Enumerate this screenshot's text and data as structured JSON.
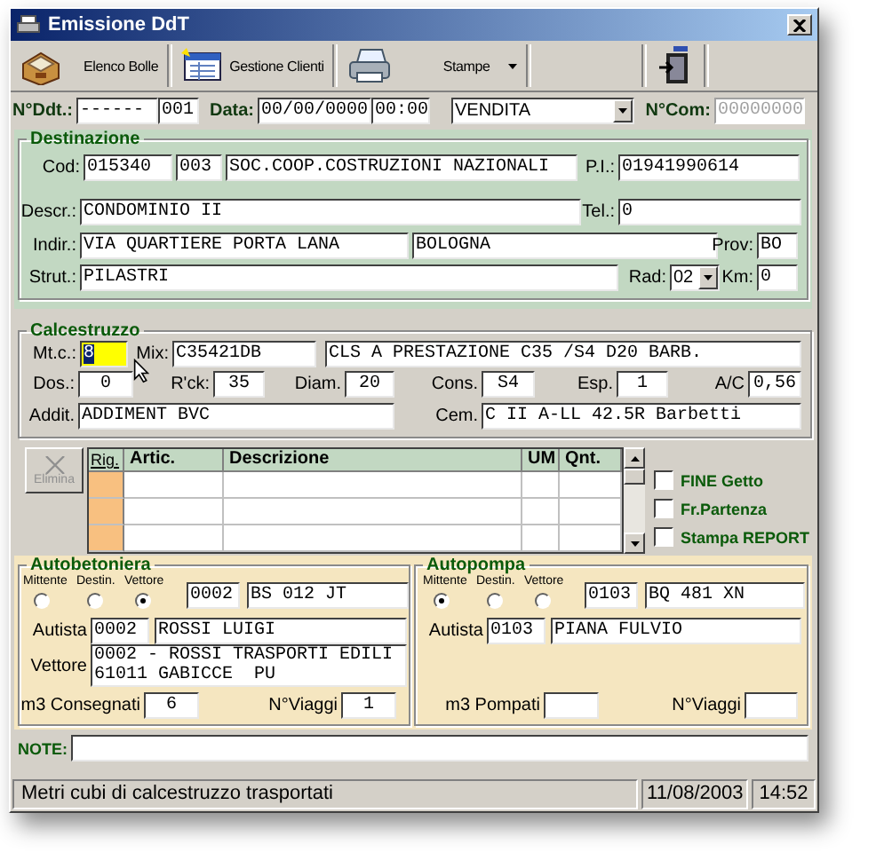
{
  "window": {
    "title": "Emissione DdT"
  },
  "toolbar": [
    {
      "label": "Elenco Bolle",
      "dropdown": false
    },
    {
      "label": "Gestione Clienti",
      "dropdown": false
    },
    {
      "label": "Stampe",
      "dropdown": true
    }
  ],
  "header": {
    "ddt_label": "N°Ddt.:",
    "ddt_prefix": "------",
    "ddt_number": "001",
    "date_label": "Data:",
    "date": "00/00/0000",
    "time": "00:00",
    "type": "VENDITA",
    "com_label": "N°Com:",
    "com": "00000000",
    "com_disabled": true
  },
  "destination": {
    "title": "Destinazione",
    "rows": [
      [
        {
          "label": "Cod:",
          "kind": "text",
          "values": [
            "015340",
            "003",
            "SOC.COOP.COSTRUZIONI NAZIONALI"
          ]
        },
        {
          "label": "P.I.:",
          "kind": "text",
          "values": [
            "01941990614"
          ]
        }
      ],
      [
        {
          "label": "Descr.:",
          "kind": "text",
          "values": [
            "CONDOMINIO II"
          ]
        },
        {
          "label": "Tel.:",
          "kind": "text",
          "values": [
            "0"
          ]
        }
      ],
      [
        {
          "label": "Indir.:",
          "kind": "text",
          "values": [
            "VIA QUARTIERE PORTA LANA",
            "BOLOGNA"
          ]
        },
        {
          "label": "Prov:",
          "kind": "text",
          "values": [
            "BO"
          ]
        }
      ],
      [
        {
          "label": "Strut.:",
          "kind": "text",
          "values": [
            "PILASTRI"
          ]
        },
        {
          "label": "Rad:",
          "kind": "combo",
          "values": [
            "02"
          ]
        },
        {
          "label": "Km:",
          "kind": "text",
          "values": [
            "0"
          ]
        }
      ]
    ]
  },
  "concrete": {
    "title": "Calcestruzzo",
    "rows": [
      [
        {
          "label": "Mt.c.:",
          "focused": true,
          "values": [
            "8"
          ]
        },
        {
          "label": "Mix:",
          "focused": false,
          "values": [
            "C35421DB",
            "CLS A PRESTAZIONE C35 /S4 D20 BARB."
          ]
        }
      ],
      [
        {
          "label": "Dos.:",
          "focused": false,
          "values": [
            "0"
          ]
        },
        {
          "label": "R'ck:",
          "focused": false,
          "values": [
            "35"
          ]
        },
        {
          "label": "Diam.",
          "focused": false,
          "values": [
            "20"
          ]
        },
        {
          "label": "Cons.",
          "focused": false,
          "values": [
            "S4"
          ]
        },
        {
          "label": "Esp.",
          "focused": false,
          "values": [
            "1"
          ]
        },
        {
          "label": "A/C",
          "focused": false,
          "values": [
            "0,56"
          ]
        }
      ],
      [
        {
          "label": "Addit.",
          "focused": false,
          "values": [
            "ADDIMENT BVC"
          ]
        },
        {
          "label": "Cem.",
          "focused": false,
          "values": [
            "C II A-LL 42.5R Barbetti"
          ]
        }
      ]
    ]
  },
  "lines": {
    "delete_button": {
      "label": "Elimina",
      "disabled": true
    },
    "columns": [
      "Rig.",
      "Artic.",
      "Descrizione",
      "UM",
      "Qnt."
    ]
  },
  "options": [
    {
      "label": "FINE Getto",
      "checked": false
    },
    {
      "label": "Fr.Partenza",
      "checked": false
    },
    {
      "label": "Stampa REPORT",
      "checked": false
    }
  ],
  "vehicles": [
    {
      "title": "Autobetoniera",
      "choices": [
        {
          "label": "Mittente",
          "selected": false
        },
        {
          "label": "Destin.",
          "selected": false
        },
        {
          "label": "Vettore",
          "selected": true
        }
      ],
      "code": "0002",
      "plate": "BS 012 JT",
      "driver": {
        "label": "Autista",
        "code": "0002",
        "name": "ROSSI LUIGI"
      },
      "carrier": {
        "label": "Vettore",
        "lines": [
          "0002 - ROSSI TRASPORTI EDILI",
          "61011 GABICCE  PU"
        ]
      },
      "quantity": {
        "label": "m3 Consegnati",
        "value": "6"
      },
      "trips": {
        "label": "N°Viaggi",
        "value": "1"
      }
    },
    {
      "title": "Autopompa",
      "choices": [
        {
          "label": "Mittente",
          "selected": true
        },
        {
          "label": "Destin.",
          "selected": false
        },
        {
          "label": "Vettore",
          "selected": false
        }
      ],
      "code": "0103",
      "plate": "BQ 481 XN",
      "driver": {
        "label": "Autista",
        "code": "0103",
        "name": "PIANA FULVIO"
      },
      "quantity": {
        "label": "m3 Pompati"
      },
      "trips": {
        "label": "N°Viaggi"
      }
    }
  ],
  "note": {
    "label": "NOTE:"
  },
  "status_bar": [
    "Metri cubi di calcestruzzo trasportati",
    "11/08/2003",
    "14:52"
  ]
}
